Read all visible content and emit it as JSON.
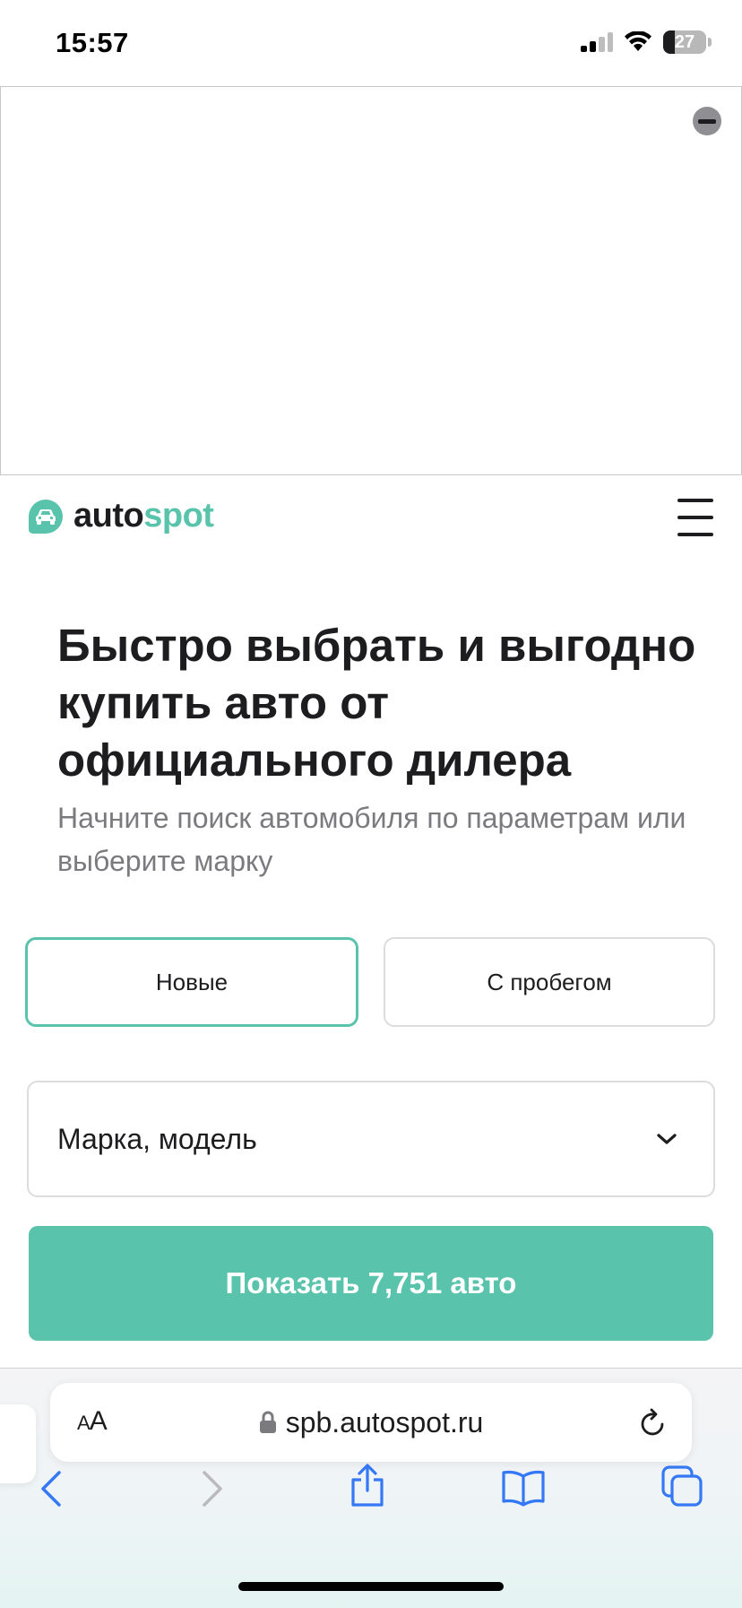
{
  "status": {
    "time": "15:57",
    "battery": "27",
    "battery_level": 0.27
  },
  "header": {
    "logo_part1": "auto",
    "logo_part2": "spot"
  },
  "hero": {
    "title": "Быстро выбрать и выгодно купить авто от официального дилера",
    "subtitle": "Начните поиск автомобиля по параметрам или выберите марку"
  },
  "filters": {
    "new_label": "Новые",
    "used_label": "С пробегом",
    "selected": "Новые"
  },
  "search": {
    "make_model_placeholder": "Марка, модель",
    "show_button": "Показать 7,751 авто"
  },
  "browser": {
    "aa_label_big": "A",
    "aa_label_small": "A",
    "url": "spb.autospot.ru"
  },
  "colors": {
    "accent": "#5ac3ab",
    "text": "#1d1d1f",
    "muted": "#7a7a7f",
    "ios_blue": "#3478f6"
  }
}
